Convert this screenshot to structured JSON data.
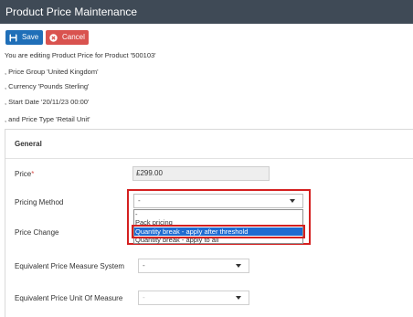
{
  "window": {
    "title": "Product Price Maintenance"
  },
  "toolbar": {
    "save_label": "Save",
    "cancel_label": "Cancel"
  },
  "info_lines": [
    "You are editing Product Price for Product '500103'",
    ", Price Group 'United Kingdom'",
    ", Currency 'Pounds Sterling'",
    ", Start Date '20/11/23 00:00'",
    ", and Price Type 'Retail Unit'"
  ],
  "section": {
    "title": "General"
  },
  "form": {
    "price_label": "Price",
    "price_required_marker": "*",
    "price_value": "£299.00",
    "pricing_method_label": "Pricing Method",
    "pricing_method_value": "-",
    "price_change_label": "Price Change",
    "equiv_measure_label": "Equivalent Price Measure System",
    "equiv_measure_value": "-",
    "equiv_uom_label": "Equivalent Price Unit Of Measure",
    "equiv_uom_value": "-"
  },
  "pricing_method_options": [
    "-",
    "Pack pricing",
    "Quantity break - apply after threshold",
    "Quantity break - apply to all"
  ],
  "highlighted_option": "Quantity break - apply after threshold",
  "colors": {
    "titlebar": "#3f4a56",
    "save_button": "#1f6fb8",
    "cancel_button": "#d9534f",
    "highlight_outline": "#d42020",
    "selected_option": "#1e6bd1"
  },
  "icons": {
    "save": "floppy-disk-icon",
    "cancel": "x-circle-icon",
    "dropdown": "caret-down-icon"
  }
}
